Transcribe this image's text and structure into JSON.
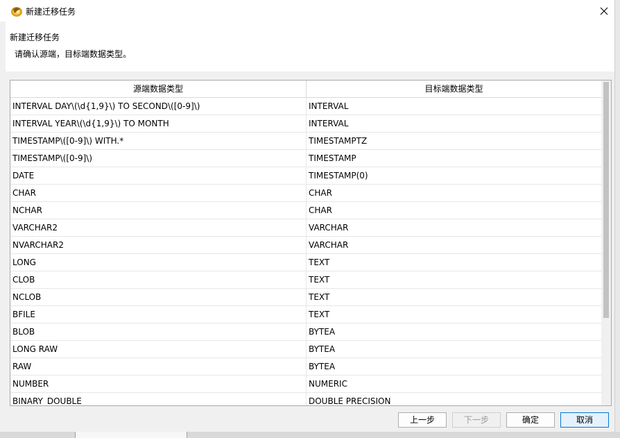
{
  "window": {
    "title": "新建迁移任务",
    "icon": "app-logo-icon",
    "close_icon": "close-icon"
  },
  "header": {
    "title": "新建迁移任务",
    "description": "请确认源端，目标端数据类型。"
  },
  "table": {
    "columns": [
      "源端数据类型",
      "目标端数据类型"
    ],
    "rows": [
      [
        "INTERVAL DAY\\(\\d{1,9}\\) TO SECOND\\([0-9]\\)",
        "INTERVAL"
      ],
      [
        "INTERVAL YEAR\\(\\d{1,9}\\) TO MONTH",
        "INTERVAL"
      ],
      [
        "TIMESTAMP\\([0-9]\\) WITH.*",
        "TIMESTAMPTZ"
      ],
      [
        "TIMESTAMP\\([0-9]\\)",
        "TIMESTAMP"
      ],
      [
        "DATE",
        "TIMESTAMP(0)"
      ],
      [
        "CHAR",
        "CHAR"
      ],
      [
        "NCHAR",
        "CHAR"
      ],
      [
        "VARCHAR2",
        "VARCHAR"
      ],
      [
        "NVARCHAR2",
        "VARCHAR"
      ],
      [
        "LONG",
        "TEXT"
      ],
      [
        "CLOB",
        "TEXT"
      ],
      [
        "NCLOB",
        "TEXT"
      ],
      [
        "BFILE",
        "TEXT"
      ],
      [
        "BLOB",
        "BYTEA"
      ],
      [
        "LONG RAW",
        "BYTEA"
      ],
      [
        "RAW",
        "BYTEA"
      ],
      [
        "NUMBER",
        "NUMERIC"
      ],
      [
        "BINARY_DOUBLE",
        "DOUBLE PRECISION"
      ]
    ]
  },
  "buttons": {
    "prev": "上一步",
    "next": "下一步",
    "ok": "确定",
    "cancel": "取消"
  }
}
